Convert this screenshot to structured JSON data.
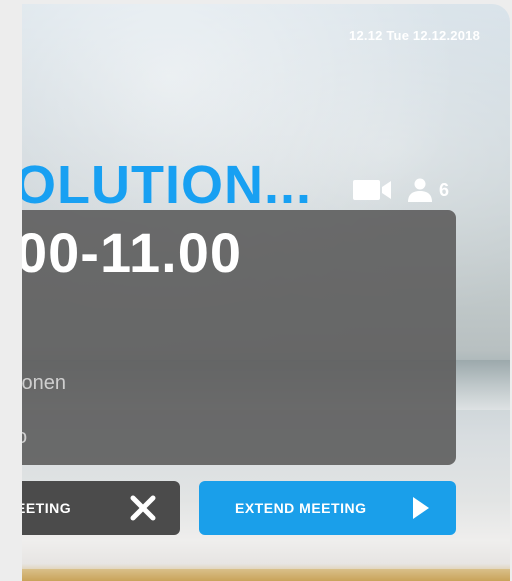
{
  "header": {
    "datetime": "12.12 Tue 12.12.2018"
  },
  "meeting": {
    "title": "OLUTION...",
    "participants": "6",
    "time": "00-11.00",
    "row1": "tonen",
    "row2": "o"
  },
  "actions": {
    "end_label": "EETING",
    "extend_label": "EXTEND MEETING"
  },
  "icons": {
    "video": "video-camera-icon",
    "person": "person-icon",
    "close": "close-icon",
    "extend": "play-arrow-icon"
  },
  "colors": {
    "accent": "#18a0f2",
    "extend_button": "#1a9fea",
    "end_button": "#4b4b4b",
    "panel": "#606060"
  }
}
